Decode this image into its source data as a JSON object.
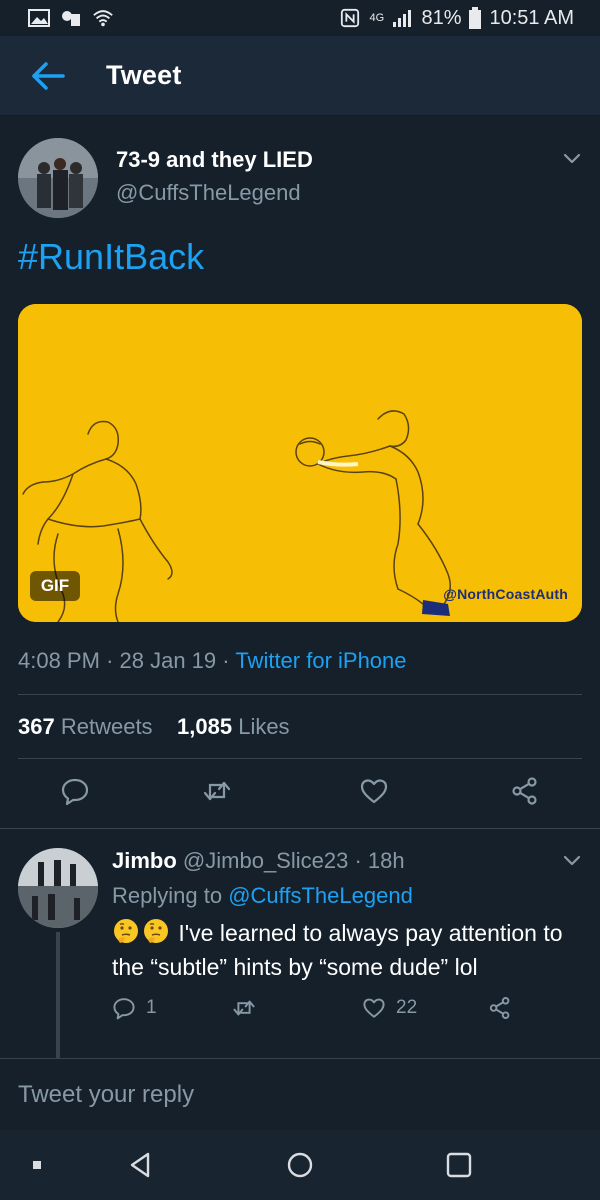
{
  "status_bar": {
    "battery": "81%",
    "time": "10:51 AM",
    "network": "4G"
  },
  "header": {
    "title": "Tweet"
  },
  "tweet": {
    "author_name": "73-9 and they LIED",
    "author_handle": "@CuffsTheLegend",
    "text": "#RunItBack",
    "media_badge": "GIF",
    "media_watermark": "@NorthCoastAuth",
    "time": "4:08 PM",
    "date": "28 Jan 19",
    "source": "Twitter for iPhone",
    "retweet_count": "367",
    "retweet_label": "Retweets",
    "like_count": "1,085",
    "like_label": "Likes"
  },
  "reply": {
    "name": "Jimbo",
    "handle": "@Jimbo_Slice23",
    "age": "18h",
    "replying_prefix": "Replying to",
    "replying_to": "@CuffsTheLegend",
    "text": "I've learned to always pay attention to the “subtle” hints by “some dude” lol",
    "reply_count": "1",
    "like_count": "22"
  },
  "composer": {
    "placeholder": "Tweet your reply"
  },
  "colors": {
    "background": "#15202b",
    "header": "#1c2938",
    "accent": "#1da1f2",
    "secondary_text": "#8899a6",
    "media_yellow": "#f7be06"
  },
  "icons": [
    "image-icon",
    "wifi-icon",
    "nfc-icon",
    "signal-icon",
    "battery-icon",
    "back-arrow-icon",
    "chevron-down-icon",
    "reply-icon",
    "retweet-icon",
    "like-icon",
    "share-icon",
    "thinking-emoji-icon",
    "recent-apps-icon",
    "nav-back-icon",
    "home-icon",
    "overview-icon"
  ]
}
